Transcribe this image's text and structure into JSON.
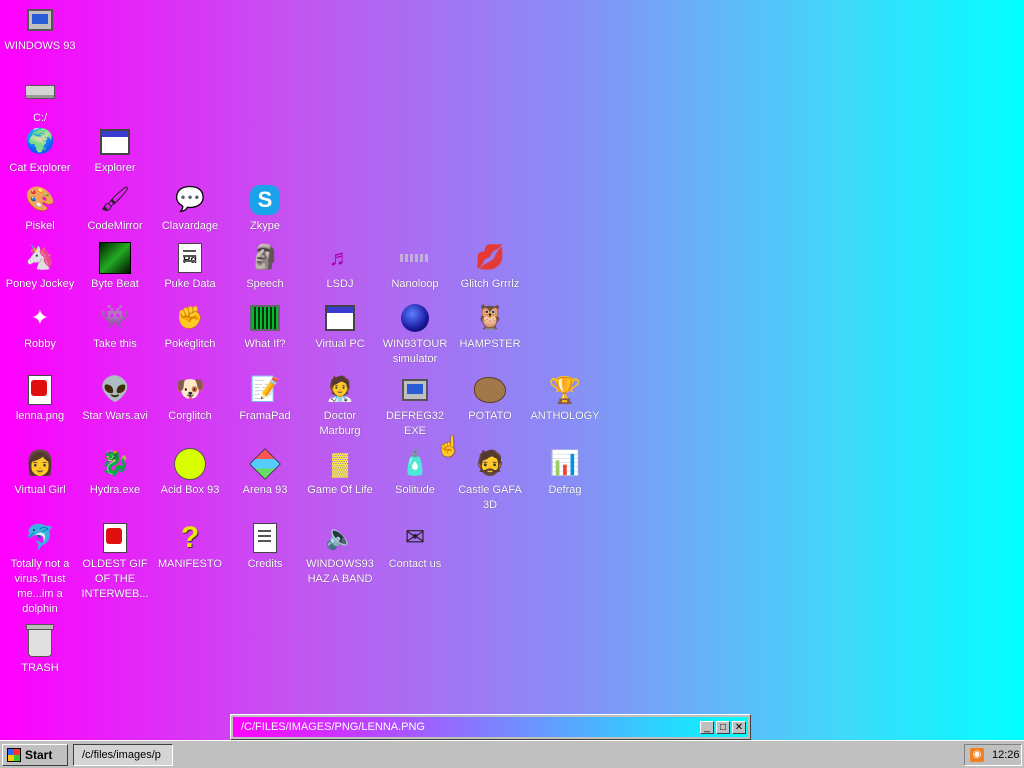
{
  "desktop": {
    "icons": [
      {
        "label": "WINDOWS 93",
        "icon": "computer-icon"
      },
      {
        "label": "C:/",
        "icon": "drive-icon"
      },
      {
        "label": "Cat Explorer",
        "icon": "cat-globe-icon"
      },
      {
        "label": "Explorer",
        "icon": "explorer-window-icon"
      },
      {
        "label": "Piskel",
        "icon": "paint-palette-icon"
      },
      {
        "label": "CodeMirror",
        "icon": "codemirror-icon"
      },
      {
        "label": "Clavardage",
        "icon": "chat-bubble-icon"
      },
      {
        "label": "Zkype",
        "icon": "zkype-icon"
      },
      {
        "label": "Poney Jockey",
        "icon": "pony-icon"
      },
      {
        "label": "Byte Beat",
        "icon": "bytebeat-icon"
      },
      {
        "label": "Puke Data",
        "icon": "pd-icon"
      },
      {
        "label": "Speech",
        "icon": "speech-face-icon"
      },
      {
        "label": "LSDJ",
        "icon": "lsdj-icon"
      },
      {
        "label": "Nanoloop",
        "icon": "nanoloop-icon"
      },
      {
        "label": "Glitch Grrrlz",
        "icon": "lips-icon"
      },
      {
        "label": "Robby",
        "icon": "robby-icon"
      },
      {
        "label": "Take this",
        "icon": "take-this-icon"
      },
      {
        "label": "Pokéglitch",
        "icon": "pokeglitch-icon"
      },
      {
        "label": "What If?",
        "icon": "what-if-icon"
      },
      {
        "label": "Virtual PC",
        "icon": "virtual-pc-icon"
      },
      {
        "label": "WIN93TOUR\nsimulator",
        "icon": "black-hole-icon"
      },
      {
        "label": "HAMPSTER",
        "icon": "hampster-icon"
      },
      {
        "label": "lenna.png",
        "icon": "image-file-icon"
      },
      {
        "label": "Star Wars.avi",
        "icon": "yoda-icon"
      },
      {
        "label": "Corglitch",
        "icon": "corgi-icon"
      },
      {
        "label": "FramaPad",
        "icon": "framapad-icon"
      },
      {
        "label": "Doctor\nMarburg",
        "icon": "doctor-icon"
      },
      {
        "label": "DEFREG32\nEXE",
        "icon": "defreg-icon"
      },
      {
        "label": "POTATO",
        "icon": "potato-icon"
      },
      {
        "label": "ANTHOLOGY",
        "icon": "trophy-icon"
      },
      {
        "label": "Virtual Girl",
        "icon": "virtual-girl-icon"
      },
      {
        "label": "Hydra.exe",
        "icon": "hydra-icon"
      },
      {
        "label": "Acid Box 93",
        "icon": "acid-smiley-icon"
      },
      {
        "label": "Arena 93",
        "icon": "cube-icon"
      },
      {
        "label": "Game Of Life",
        "icon": "game-of-life-icon"
      },
      {
        "label": "Solitude",
        "icon": "solitude-icon"
      },
      {
        "label": "Castle GAFA\n3D",
        "icon": "castle-face-icon"
      },
      {
        "label": "Defrag",
        "icon": "defrag-icon"
      },
      {
        "label": "Totally not a\nvirus.Trust\nme...im a\ndolphin",
        "icon": "dolphin-icon"
      },
      {
        "label": "OLDEST GIF\nOF THE\nINTERWEB...",
        "icon": "gif-file-icon"
      },
      {
        "label": "MANIFESTO",
        "icon": "question-mark-icon"
      },
      {
        "label": "Credits",
        "icon": "text-file-icon"
      },
      {
        "label": "WINDOWS93\nHAZ A BAND",
        "icon": "speaker-icon"
      },
      {
        "label": "Contact us",
        "icon": "contact-icon"
      },
      {
        "label": "TRASH",
        "icon": "trash-icon"
      }
    ]
  },
  "window_bar": {
    "title": "/C/FILES/IMAGES/PNG/LENNA.PNG",
    "minimize_glyph": "_",
    "maximize_glyph": "□",
    "close_glyph": "✕"
  },
  "taskbar": {
    "start_label": "Start",
    "task_item": "/c/files/images/p",
    "clock": "12:26",
    "rss_glyph": "◉"
  }
}
